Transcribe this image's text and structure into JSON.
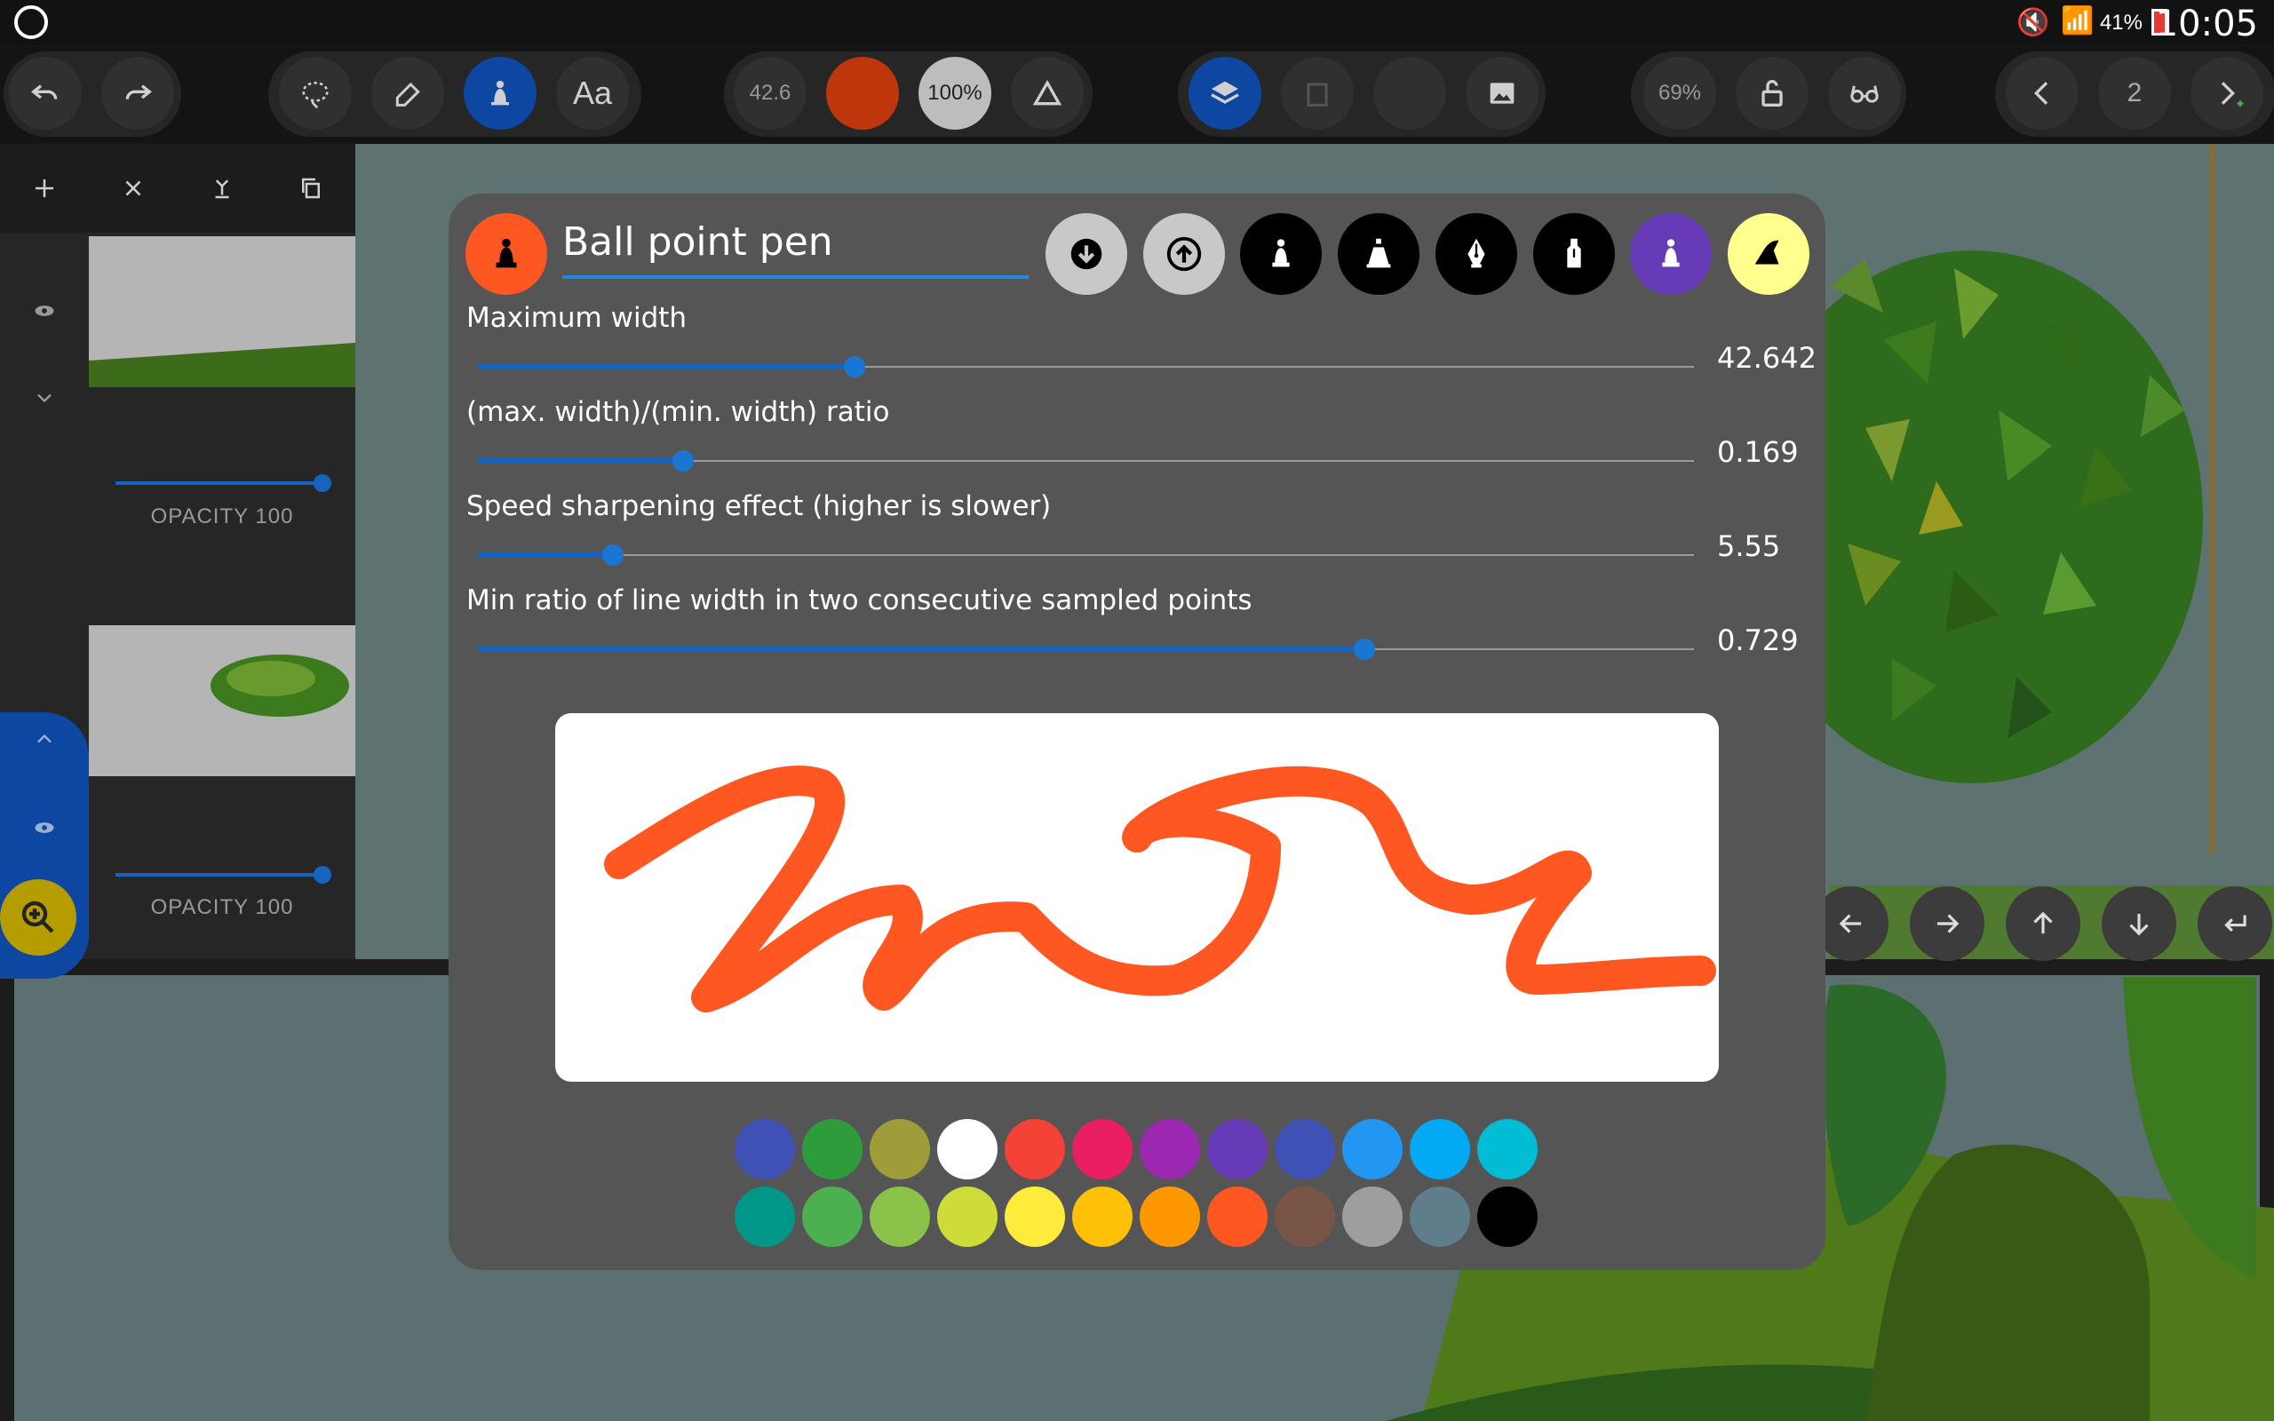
{
  "status_bar": {
    "battery": "41%",
    "time": "10:05"
  },
  "toolbar": {
    "pen_size": "42.6",
    "opacity": "100%",
    "zoom": "69%",
    "page_number": "2",
    "text_tool": "Aa"
  },
  "layers_panel": {
    "layers": [
      {
        "opacity_label": "OPACITY 100"
      },
      {
        "opacity_label": "OPACITY 100"
      }
    ]
  },
  "pen_dialog": {
    "pen_name": "Ball point pen",
    "accent_color": "#ff5722",
    "sliders": [
      {
        "label": "Maximum width",
        "value": "42.642",
        "fraction": 0.31
      },
      {
        "label": "(max. width)/(min. width) ratio",
        "value": "0.169",
        "fraction": 0.169
      },
      {
        "label": "Speed sharpening effect (higher is slower)",
        "value": "5.55",
        "fraction": 0.112
      },
      {
        "label": "Min ratio of line width in two consecutive sampled points",
        "value": "0.729",
        "fraction": 0.729
      }
    ],
    "presets": [
      {
        "icon": "download-icon",
        "bg": "#c8c8c8"
      },
      {
        "icon": "upload-icon",
        "bg": "#c8c8c8"
      },
      {
        "icon": "ballpen-icon",
        "bg": "#000000"
      },
      {
        "icon": "marker-icon",
        "bg": "#000000"
      },
      {
        "icon": "fountain-pen-icon",
        "bg": "#000000"
      },
      {
        "icon": "calligraphy-pen-icon",
        "bg": "#000000"
      },
      {
        "icon": "pencil-icon",
        "bg": "#673ab7"
      },
      {
        "icon": "highlighter-icon",
        "bg": "#ffff8d"
      }
    ],
    "palette": [
      "#3f51b5",
      "#2e9c3a",
      "#9e9d3a",
      "#ffffff",
      "#f44336",
      "#e91e63",
      "#9c27b0",
      "#673ab7",
      "#3f51b5",
      "#2196f3",
      "#03a9f4",
      "#00bcd4",
      "#009688",
      "#4caf50",
      "#8bc34a",
      "#cddc39",
      "#ffeb3b",
      "#ffc107",
      "#ff9800",
      "#ff5722",
      "#795548",
      "#9e9e9e",
      "#607d8b",
      "#000000"
    ]
  }
}
